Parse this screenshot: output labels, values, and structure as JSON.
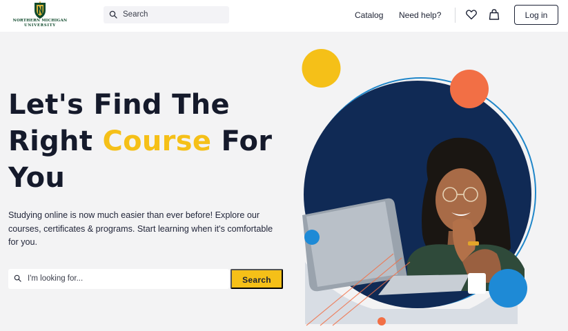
{
  "header": {
    "logo_line1": "NORTHERN MICHIGAN",
    "logo_line2": "UNIVERSITY",
    "search_placeholder": "Search",
    "nav": {
      "catalog": "Catalog",
      "help": "Need help?"
    },
    "login_label": "Log in"
  },
  "hero": {
    "title": {
      "line1": "Let's Find The",
      "line2_start": "Right ",
      "line2_accent": "Course",
      "line2_end": " For",
      "line3": "You"
    },
    "description": "Studying online is now much easier than ever before! Explore our courses, certificates & programs. Start learning when it's comfortable for you.",
    "search_placeholder": "I'm looking for...",
    "search_button": "Search"
  },
  "colors": {
    "accent_yellow": "#f5c018",
    "accent_orange": "#f26f45",
    "accent_blue": "#1e8ad6",
    "navy": "#102a55",
    "text_dark": "#151a2b",
    "logo_green": "#0f4a2c"
  },
  "icons": [
    "search-icon",
    "heart-icon",
    "bag-icon"
  ]
}
